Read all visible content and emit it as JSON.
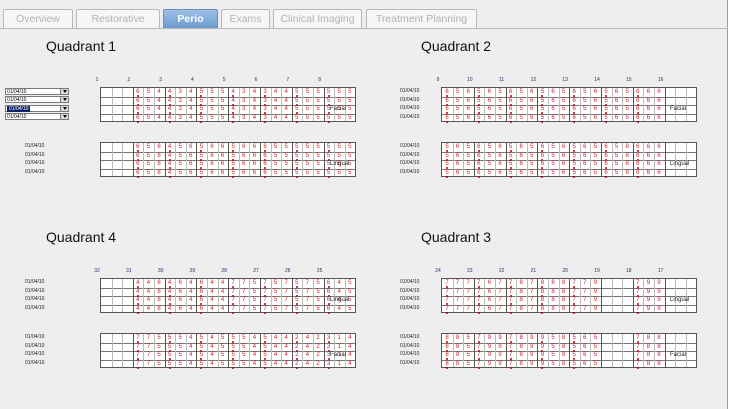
{
  "tabs": [
    {
      "label": "Overview",
      "active": false
    },
    {
      "label": "Restorative",
      "active": false
    },
    {
      "label": "Perio",
      "active": true
    },
    {
      "label": "Exams",
      "active": false
    },
    {
      "label": "Clinical Imaging",
      "active": false
    },
    {
      "label": "Treatment Planning",
      "active": false
    }
  ],
  "colors": {
    "tab_active": "#7aa5d8",
    "measure": "#d0202a",
    "alt_measure": "#2a8a2a",
    "background": "#eeeeee"
  },
  "quadrants": [
    {
      "title": "Quadrant 1",
      "teeth": [
        "1",
        "2",
        "3",
        "4",
        "5",
        "6",
        "7",
        "8"
      ],
      "tooth_cols": [
        0,
        1,
        2,
        3,
        4,
        5,
        6,
        7
      ],
      "top_label": "Facial",
      "bottom_label": "Lingual",
      "top_dates_dropdown": true,
      "top_dates": [
        "01/04/10",
        "01/04/10",
        "01/04/10",
        "01/04/10"
      ],
      "bottom_dates": [
        "01/04/10",
        "01/04/10",
        "01/04/10",
        "01/04/10"
      ],
      "top_rows": [
        [
          "",
          "",
          "",
          "6",
          "5",
          "4",
          "4",
          "3",
          "4",
          "5",
          "5",
          "5",
          "4",
          "3",
          "4",
          "3",
          "4",
          "4",
          "5",
          "5",
          "5",
          "5",
          "5",
          "5"
        ],
        [
          "",
          "",
          "",
          "6",
          "5",
          "4",
          "4",
          "3",
          "4",
          "5",
          "5",
          "5",
          "4",
          "3",
          "4",
          "3",
          "4",
          "4",
          "5",
          "5",
          "5",
          "5",
          "5",
          "5"
        ],
        [
          "",
          "",
          "",
          "6",
          "5",
          "4",
          "4",
          "3",
          "4",
          "5",
          "5",
          "5",
          "4",
          "3",
          "4",
          "3",
          "4",
          "4",
          "5",
          "5",
          "5",
          "5",
          "5",
          "5"
        ],
        [
          "",
          "",
          "",
          "6",
          "5",
          "4",
          "4",
          "3",
          "4",
          "5",
          "5",
          "5",
          "4",
          "3",
          "4",
          "3",
          "4",
          "4",
          "5",
          "5",
          "5",
          "5",
          "5",
          "5"
        ]
      ],
      "bottom_rows": [
        [
          "",
          "",
          "",
          "6",
          "5",
          "8",
          "4",
          "5",
          "6",
          "5",
          "6",
          "6",
          "5",
          "6",
          "6",
          "6",
          "5",
          "5",
          "5",
          "5",
          "5",
          "5",
          "5",
          "5"
        ],
        [
          "",
          "",
          "",
          "6",
          "5",
          "8",
          "4",
          "5",
          "6",
          "5",
          "6",
          "6",
          "5",
          "6",
          "6",
          "6",
          "5",
          "5",
          "5",
          "5",
          "5",
          "5",
          "5",
          "5"
        ],
        [
          "",
          "",
          "",
          "6",
          "5",
          "8",
          "4",
          "5",
          "6",
          "5",
          "6",
          "6",
          "5",
          "6",
          "6",
          "6",
          "5",
          "5",
          "5",
          "5",
          "5",
          "5",
          "5",
          "5"
        ],
        [
          "",
          "",
          "",
          "6",
          "5",
          "8",
          "4",
          "5",
          "6",
          "5",
          "6",
          "6",
          "5",
          "6",
          "6",
          "6",
          "5",
          "5",
          "5",
          "5",
          "5",
          "5",
          "5",
          "5"
        ]
      ]
    },
    {
      "title": "Quadrant 2",
      "teeth": [
        "9",
        "10",
        "11",
        "12",
        "13",
        "14",
        "15",
        "16"
      ],
      "tooth_cols": [
        0,
        1,
        2,
        3,
        4,
        5,
        6,
        7
      ],
      "top_label": "Facial",
      "bottom_label": "Lingual",
      "top_dates_dropdown": false,
      "top_dates": [
        "01/04/10",
        "01/04/10",
        "01/04/10",
        "01/04/10"
      ],
      "bottom_dates": [
        "01/04/10",
        "01/04/10",
        "01/04/10",
        "01/04/10"
      ],
      "top_rows": [
        [
          "6",
          "5",
          "6",
          "5",
          "6",
          "5",
          "6",
          "5",
          "6",
          "5",
          "6",
          "5",
          "6",
          "5",
          "6",
          "5",
          "6",
          "5",
          "6",
          "6",
          "6",
          "",
          "",
          ""
        ],
        [
          "6",
          "5",
          "6",
          "5",
          "6",
          "5",
          "6",
          "5",
          "6",
          "5",
          "6",
          "5",
          "6",
          "5",
          "6",
          "5",
          "6",
          "5",
          "6",
          "6",
          "6",
          "",
          "",
          ""
        ],
        [
          "6",
          "5",
          "6",
          "5",
          "6",
          "5",
          "6",
          "5",
          "6",
          "5",
          "6",
          "5",
          "6",
          "5",
          "6",
          "5",
          "6",
          "5",
          "6",
          "6",
          "6",
          "",
          "",
          ""
        ],
        [
          "6",
          "5",
          "6",
          "5",
          "6",
          "5",
          "6",
          "5",
          "6",
          "5",
          "6",
          "5",
          "6",
          "5",
          "6",
          "5",
          "6",
          "5",
          "6",
          "6",
          "6",
          "",
          "",
          ""
        ]
      ],
      "bottom_rows": [
        [
          "5",
          "6",
          "5",
          "6",
          "5",
          "6",
          "5",
          "6",
          "5",
          "6",
          "5",
          "6",
          "5",
          "6",
          "5",
          "6",
          "5",
          "8",
          "6",
          "6",
          "6",
          "",
          "",
          ""
        ],
        [
          "5",
          "6",
          "5",
          "6",
          "5",
          "6",
          "5",
          "6",
          "5",
          "6",
          "5",
          "6",
          "5",
          "6",
          "5",
          "6",
          "5",
          "8",
          "6",
          "6",
          "6",
          "",
          "",
          ""
        ],
        [
          "5",
          "6",
          "5",
          "6",
          "5",
          "6",
          "5",
          "6",
          "5",
          "6",
          "5",
          "6",
          "5",
          "6",
          "5",
          "6",
          "5",
          "8",
          "6",
          "6",
          "6",
          "",
          "",
          ""
        ],
        [
          "5",
          "6",
          "5",
          "6",
          "5",
          "6",
          "5",
          "6",
          "5",
          "6",
          "5",
          "6",
          "5",
          "6",
          "5",
          "6",
          "5",
          "8",
          "6",
          "6",
          "6",
          "",
          "",
          ""
        ]
      ]
    },
    {
      "title": "Quadrant 4",
      "teeth": [
        "32",
        "31",
        "30",
        "29",
        "28",
        "27",
        "26",
        "25"
      ],
      "tooth_cols": [
        0,
        1,
        2,
        3,
        4,
        5,
        6,
        7
      ],
      "top_label": "Lingual",
      "bottom_label": "Facial",
      "top_dates_dropdown": false,
      "top_dates": [
        "01/04/10",
        "01/04/10",
        "01/04/10",
        "01/04/10"
      ],
      "bottom_dates": [
        "01/04/10",
        "01/04/10",
        "01/04/10",
        "01/04/10"
      ],
      "top_rows": [
        [
          "",
          "",
          "",
          "4",
          "4",
          "8",
          "4",
          "6",
          "4",
          "6",
          "4",
          "4",
          "7",
          "7",
          "5",
          "7",
          "5",
          "7",
          "5",
          "7",
          "5",
          "6",
          "4",
          "5"
        ],
        [
          "",
          "",
          "",
          "4",
          "4",
          "8",
          "4",
          "6",
          "4",
          "6",
          "4",
          "4",
          "7",
          "7",
          "5",
          "7",
          "5",
          "7",
          "5",
          "7",
          "5",
          "6",
          "4",
          "5"
        ],
        [
          "",
          "",
          "",
          "4",
          "4",
          "8",
          "4",
          "6",
          "4",
          "6",
          "4",
          "4",
          "7",
          "7",
          "5",
          "7",
          "5",
          "7",
          "5",
          "7",
          "5",
          "6",
          "4",
          "5"
        ],
        [
          "",
          "",
          "",
          "4",
          "4",
          "8",
          "4",
          "6",
          "4",
          "6",
          "4",
          "4",
          "7",
          "7",
          "5",
          "7",
          "5",
          "7",
          "5",
          "7",
          "5",
          "6",
          "4",
          "5"
        ]
      ],
      "bottom_rows": [
        [
          "",
          "",
          "",
          "7",
          "7",
          "5",
          "5",
          "5",
          "4",
          "5",
          "4",
          "5",
          "5",
          "5",
          "4",
          "5",
          "4",
          "4",
          "2",
          "4",
          "2",
          "3",
          "1",
          "4"
        ],
        [
          "",
          "",
          "",
          "7",
          "7",
          "5",
          "5",
          "5",
          "4",
          "5",
          "4",
          "5",
          "5",
          "5",
          "4",
          "5",
          "4",
          "4",
          "2",
          "4",
          "2",
          "3",
          "1",
          "4"
        ],
        [
          "",
          "",
          "",
          "7",
          "7",
          "5",
          "5",
          "5",
          "4",
          "5",
          "4",
          "5",
          "5",
          "5",
          "4",
          "5",
          "4",
          "4",
          "2",
          "4",
          "2",
          "3",
          "1",
          "4"
        ],
        [
          "",
          "",
          "",
          "7",
          "7",
          "5",
          "5",
          "5",
          "4",
          "5",
          "4",
          "5",
          "5",
          "5",
          "4",
          "5",
          "4",
          "4",
          "2",
          "4",
          "2",
          "3",
          "1",
          "4"
        ]
      ]
    },
    {
      "title": "Quadrant 3",
      "teeth": [
        "24",
        "23",
        "22",
        "21",
        "20",
        "19",
        "18",
        "17"
      ],
      "tooth_cols": [
        0,
        1,
        2,
        3,
        4,
        5,
        6,
        7
      ],
      "top_label": "Lingual",
      "bottom_label": "Facial",
      "top_dates_dropdown": false,
      "top_dates": [
        "01/04/10",
        "01/04/10",
        "01/04/10",
        "01/04/10"
      ],
      "bottom_dates": [
        "01/04/10",
        "01/04/10",
        "01/04/10",
        "01/04/10"
      ],
      "top_rows": [
        [
          "7",
          "7",
          "7",
          "7",
          "6",
          "7",
          "7",
          "8",
          "7",
          "8",
          "8",
          "8",
          "7",
          "7",
          "9",
          "",
          "",
          "",
          "7",
          "9",
          "9",
          "",
          "",
          ""
        ],
        [
          "7",
          "7",
          "7",
          "7",
          "6",
          "7",
          "7",
          "8",
          "7",
          "8",
          "8",
          "8",
          "7",
          "7",
          "9",
          "",
          "",
          "",
          "7",
          "9",
          "9",
          "",
          "",
          ""
        ],
        [
          "7",
          "7",
          "7",
          "7",
          "6",
          "7",
          "7",
          "8",
          "7",
          "8",
          "8",
          "8",
          "7",
          "7",
          "9",
          "",
          "",
          "",
          "7",
          "9",
          "9",
          "",
          "",
          ""
        ],
        [
          "7",
          "7",
          "7",
          "7",
          "6",
          "7",
          "7",
          "8",
          "7",
          "8",
          "8",
          "8",
          "7",
          "7",
          "9",
          "",
          "",
          "",
          "7",
          "9",
          "9",
          "",
          "",
          ""
        ]
      ],
      "bottom_rows": [
        [
          "8",
          "8",
          "5",
          "7",
          "9",
          "9",
          "7",
          "8",
          "9",
          "9",
          "5",
          "8",
          "5",
          "6",
          "5",
          "",
          "",
          "",
          "7",
          "8",
          "8",
          "",
          "",
          ""
        ],
        [
          "8",
          "8",
          "5",
          "7",
          "9",
          "9",
          "7",
          "8",
          "9",
          "9",
          "5",
          "8",
          "5",
          "6",
          "5",
          "",
          "",
          "",
          "7",
          "8",
          "8",
          "",
          "",
          ""
        ],
        [
          "8",
          "8",
          "5",
          "7",
          "9",
          "9",
          "7",
          "8",
          "9",
          "9",
          "5",
          "8",
          "5",
          "6",
          "5",
          "",
          "",
          "",
          "7",
          "8",
          "8",
          "",
          "",
          ""
        ],
        [
          "8",
          "8",
          "5",
          "7",
          "9",
          "9",
          "7",
          "8",
          "9",
          "9",
          "5",
          "8",
          "5",
          "6",
          "5",
          "",
          "",
          "",
          "7",
          "8",
          "8",
          "",
          "",
          ""
        ]
      ]
    }
  ]
}
